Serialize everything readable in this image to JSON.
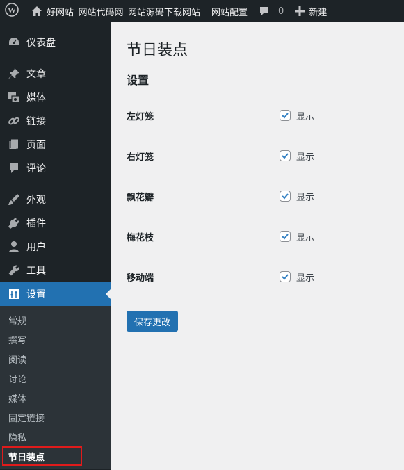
{
  "adminbar": {
    "wp_logo_icon": "wordpress-logo",
    "site_icon": "home-icon",
    "site_name": "好网站_网站代码网_网站源码下载网站",
    "config_label": "网站配置",
    "comments_icon": "comment-bubble-icon",
    "comments_count": "0",
    "new_icon": "plus-icon",
    "new_label": "新建"
  },
  "sidebar": {
    "items": [
      {
        "label": "仪表盘",
        "icon": "dashboard-icon"
      },
      {
        "label": "文章",
        "icon": "pin-icon"
      },
      {
        "label": "媒体",
        "icon": "media-icon"
      },
      {
        "label": "链接",
        "icon": "link-icon"
      },
      {
        "label": "页面",
        "icon": "page-icon"
      },
      {
        "label": "评论",
        "icon": "comment-icon"
      },
      {
        "label": "外观",
        "icon": "appearance-icon"
      },
      {
        "label": "插件",
        "icon": "plugin-icon"
      },
      {
        "label": "用户",
        "icon": "user-icon"
      },
      {
        "label": "工具",
        "icon": "wrench-icon"
      },
      {
        "label": "设置",
        "icon": "settings-icon"
      }
    ],
    "submenu": [
      "常规",
      "撰写",
      "阅读",
      "讨论",
      "媒体",
      "固定链接",
      "隐私",
      "节日装点"
    ]
  },
  "main": {
    "page_title": "节日装点",
    "section_title": "设置",
    "rows": [
      {
        "label": "左灯笼",
        "field": "显示",
        "checked": true
      },
      {
        "label": "右灯笼",
        "field": "显示",
        "checked": true
      },
      {
        "label": "飘花瓣",
        "field": "显示",
        "checked": true
      },
      {
        "label": "梅花枝",
        "field": "显示",
        "checked": true
      },
      {
        "label": "移动端",
        "field": "显示",
        "checked": true
      }
    ],
    "save_label": "保存更改"
  },
  "colors": {
    "accent": "#2271b1",
    "sidebar_bg": "#1d2327",
    "submenu_bg": "#2c3338",
    "highlight_border": "#e01b1b"
  }
}
